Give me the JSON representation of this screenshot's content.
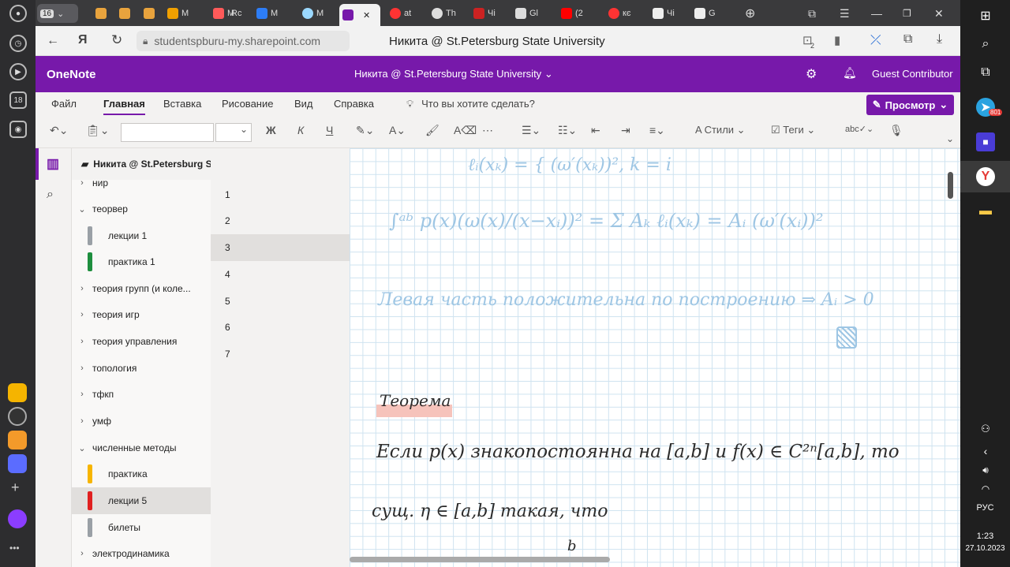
{
  "browser": {
    "tab_count_badge": "16",
    "tabs": [
      {
        "label": "M",
        "color": "#f0a000"
      },
      {
        "label": "M",
        "color": "#ff5a5a"
      },
      {
        "label": "Rc",
        "color": "#ffffff"
      },
      {
        "label": "M",
        "color": "#2d7df6"
      },
      {
        "label": "M",
        "color": "#9bd8ff"
      },
      {
        "label": "",
        "color": "#7719aa"
      },
      {
        "label": "at",
        "color": "#ff3333"
      },
      {
        "label": "Th",
        "color": "#ffffff"
      },
      {
        "label": "Чі",
        "color": "#cc2222"
      },
      {
        "label": "Gl",
        "color": "#ffffff"
      },
      {
        "label": "(2",
        "color": "#ff0000"
      },
      {
        "label": "кє",
        "color": "#ff3333"
      },
      {
        "label": "Чі",
        "color": "#ffffff"
      },
      {
        "label": "G",
        "color": "#ffffff"
      }
    ],
    "address": "studentspburu-my.sharepoint.com",
    "page_title": "Никита @ St.Petersburg State University",
    "downloads_badge": "2"
  },
  "onenote": {
    "app_name": "OneNote",
    "notebook_title": "Никита @ St.Petersburg State University",
    "user": "Guest Contributor",
    "ribbon_tabs": [
      "Файл",
      "Главная",
      "Вставка",
      "Рисование",
      "Вид",
      "Справка"
    ],
    "active_tab": "Главная",
    "tell_me": "Что вы хотите сделать?",
    "view_button": "Просмотр",
    "tools": {
      "bold": "Ж",
      "italic": "К",
      "underline": "Ч",
      "styles": "Стили",
      "tags": "Теги"
    },
    "notebook_header": "Никита @ St.Petersburg State University"
  },
  "sections": [
    {
      "label": "нир",
      "kind": "group",
      "expanded": false
    },
    {
      "label": "теорвер",
      "kind": "group",
      "expanded": true
    },
    {
      "label": "лекции 1",
      "kind": "section",
      "color": "#9aa0a6"
    },
    {
      "label": "практика 1",
      "kind": "section",
      "color": "#1e8e3e"
    },
    {
      "label": "теория групп (и коле...",
      "kind": "group",
      "expanded": false
    },
    {
      "label": "теория игр",
      "kind": "group",
      "expanded": false
    },
    {
      "label": "теория управления",
      "kind": "group",
      "expanded": false
    },
    {
      "label": "топология",
      "kind": "group",
      "expanded": false
    },
    {
      "label": "тфкп",
      "kind": "group",
      "expanded": false
    },
    {
      "label": "умф",
      "kind": "group",
      "expanded": false
    },
    {
      "label": "численные методы",
      "kind": "group",
      "expanded": true
    },
    {
      "label": "практика",
      "kind": "section",
      "color": "#f7b500"
    },
    {
      "label": "лекции 5",
      "kind": "section",
      "color": "#e02020",
      "selected": true
    },
    {
      "label": "билеты",
      "kind": "section",
      "color": "#9aa0a6"
    },
    {
      "label": "электродинамика",
      "kind": "group",
      "expanded": false
    }
  ],
  "pages": [
    "1",
    "2",
    "3",
    "4",
    "5",
    "6",
    "7"
  ],
  "selected_page": "3",
  "ink": {
    "line1": "∫ᵃᵇ p(x)(ω(x)/(x−xᵢ))² = Σ Aₖ ℓᵢ(xₖ) = Aᵢ (ω′(xᵢ))²",
    "line2": "Левая часть положительна по построению ⇒ Aᵢ > 0",
    "heading": "Теорема",
    "line3": "Если p(x) знакопостоянна на [a,b] и f(x) ∈ C²ⁿ[a,b], то",
    "line4": "сущ. η ∈ [a,b] такая, что",
    "line5": "b"
  },
  "taskbar": {
    "time": "1:23",
    "date": "27.10.2023",
    "lang": "РУС",
    "telegram_badge": "801"
  },
  "left_rail": {
    "badge": "18"
  }
}
